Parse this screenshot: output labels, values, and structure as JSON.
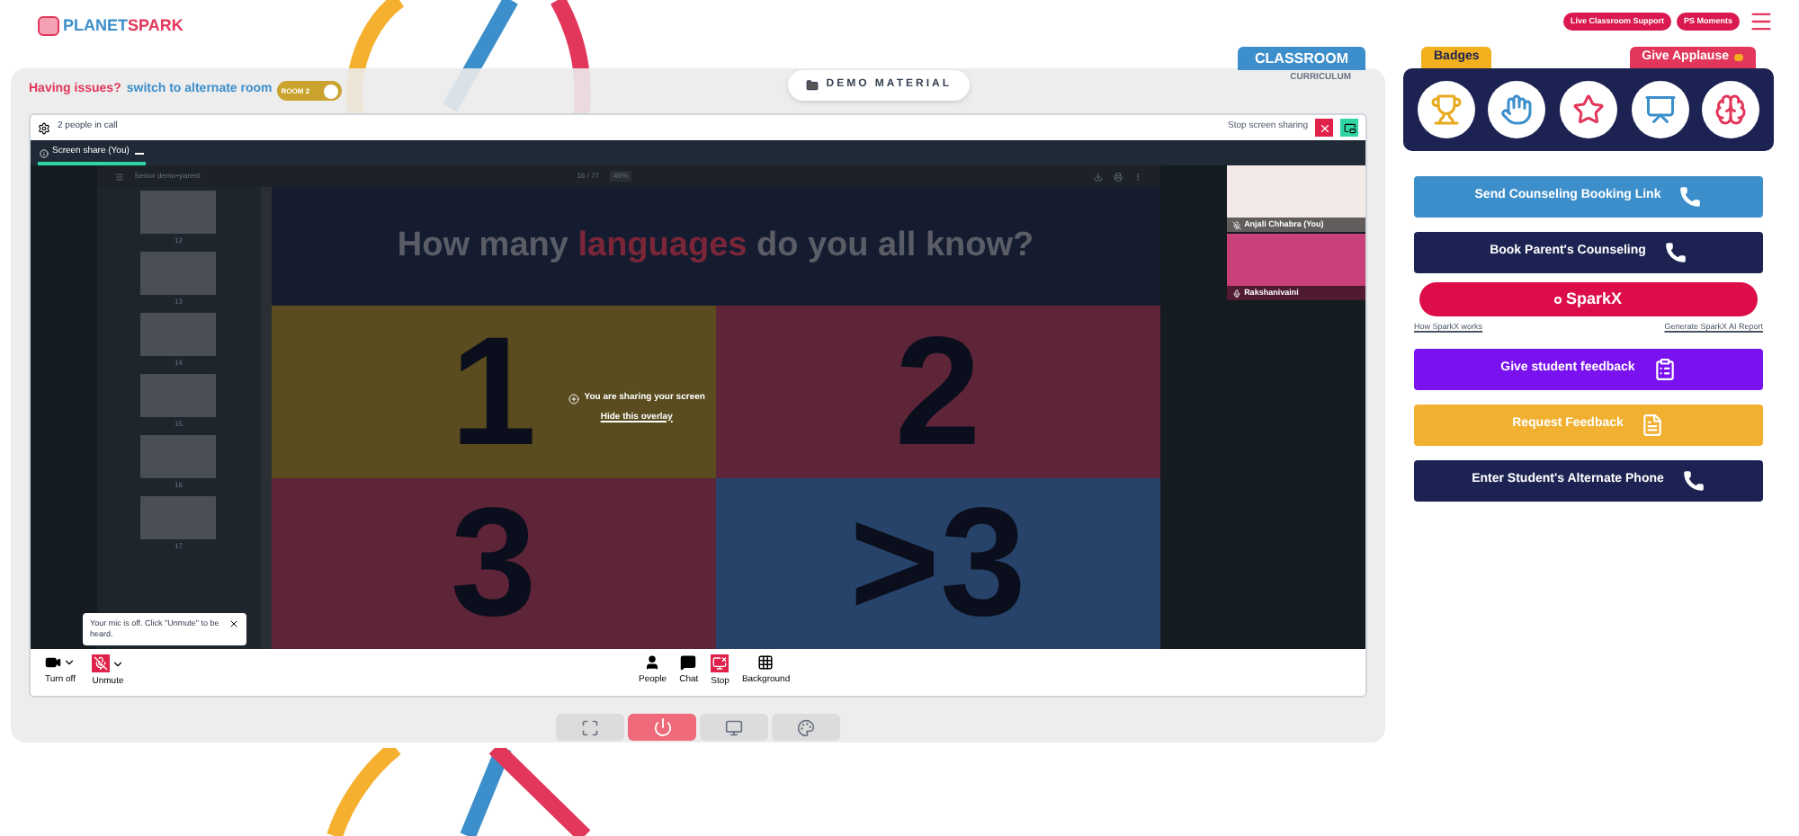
{
  "header": {
    "logo": {
      "part_1": "PLANET",
      "part_2": "SPARK"
    },
    "pills": [
      "Live Classroom Support",
      "PS Moments"
    ]
  },
  "panel_tabs": [
    {
      "label": "CLASSROOM",
      "selected": true
    },
    {
      "label": "CURRICULUM",
      "selected": false
    }
  ],
  "issue_bar": {
    "prompt": "Having issues?",
    "link": "switch to alternate room",
    "toggle": {
      "label": "ROOM 2",
      "on": true
    }
  },
  "demo_button": "DEMO MATERIAL",
  "meet": {
    "people_count": "2 people in call",
    "stop_sharing": "Stop screen sharing",
    "tab": {
      "label": "Screen share (You)",
      "selected": true
    },
    "viewer": {
      "file_name": "Senior demo+parent",
      "page": "16 / 77",
      "zoom": "40%",
      "thumbnails": [
        "12",
        "13",
        "14",
        "15",
        "16",
        "17"
      ]
    },
    "slide": {
      "title_before": "How many",
      "title_highlight": "languages",
      "title_after": "do you all know?",
      "cells": [
        {
          "label": "1",
          "color": "#5a4c1f"
        },
        {
          "label": "2",
          "color": "#5e2538"
        },
        {
          "label": "3",
          "color": "#5e2538"
        },
        {
          "label": ">3",
          "color": "#27436a"
        }
      ]
    },
    "overlay": {
      "message": "You are sharing your screen",
      "link": "Hide this overlay"
    },
    "participants": [
      {
        "name": "Anjali Chhabra (You)",
        "muted": true
      },
      {
        "name": "Rakshanivaini",
        "muted": false
      }
    ],
    "mic_tooltip": "Your mic is off. Click \"Unmute\" to be heard.",
    "controls_left": [
      {
        "label": "Turn off",
        "kind": "camera"
      },
      {
        "label": "Unmute",
        "kind": "mic"
      }
    ],
    "controls_center": [
      {
        "label": "People",
        "kind": "people"
      },
      {
        "label": "Chat",
        "kind": "chat"
      },
      {
        "label": "Stop",
        "kind": "stop"
      },
      {
        "label": "Background",
        "kind": "background"
      }
    ]
  },
  "bottom_buttons": [
    {
      "kind": "fullscreen"
    },
    {
      "kind": "power"
    },
    {
      "kind": "screen"
    },
    {
      "kind": "palette"
    }
  ],
  "right": {
    "tabs": [
      {
        "label": "Badges",
        "selected": true
      },
      {
        "label": "Give Applause",
        "selected": false
      }
    ],
    "badges": [
      {
        "kind": "trophy"
      },
      {
        "kind": "fist"
      },
      {
        "kind": "star"
      },
      {
        "kind": "podium"
      },
      {
        "kind": "brain"
      }
    ],
    "actions": [
      {
        "kind": "call",
        "label": "Send Counseling Booking Link",
        "color": "#3d8fcb"
      },
      {
        "kind": "call",
        "label": "Book Parent's Counseling",
        "color": "#1c2352"
      },
      {
        "kind": "sparkx",
        "label": "SparkX",
        "links": [
          "How SparkX works",
          "Generate SparkX AI Report"
        ]
      },
      {
        "kind": "feedback",
        "label": "Give student feedback",
        "color": "#7a12f0"
      },
      {
        "kind": "request",
        "label": "Request Feedback",
        "color": "#f2b031"
      },
      {
        "kind": "call",
        "label": "Enter Student's Alternate Phone",
        "color": "#1c2352"
      }
    ]
  }
}
